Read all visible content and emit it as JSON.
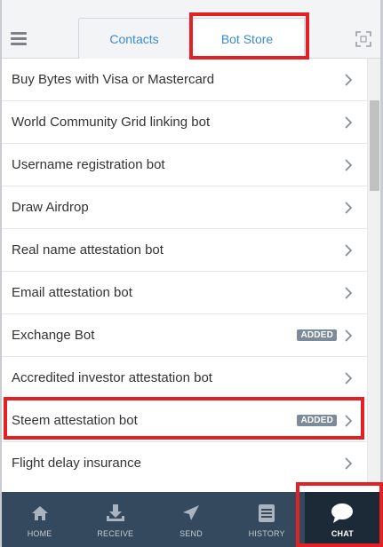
{
  "header": {
    "tabs": [
      {
        "label": "Contacts",
        "active": false
      },
      {
        "label": "Bot Store",
        "active": true
      }
    ]
  },
  "bots": [
    {
      "label": "Buy Bytes with Visa or Mastercard",
      "badge": ""
    },
    {
      "label": "World Community Grid linking bot",
      "badge": ""
    },
    {
      "label": "Username registration bot",
      "badge": ""
    },
    {
      "label": "Draw Airdrop",
      "badge": ""
    },
    {
      "label": "Real name attestation bot",
      "badge": ""
    },
    {
      "label": "Email attestation bot",
      "badge": ""
    },
    {
      "label": "Exchange Bot",
      "badge": "ADDED"
    },
    {
      "label": "Accredited investor attestation bot",
      "badge": ""
    },
    {
      "label": "Steem attestation bot",
      "badge": "ADDED"
    },
    {
      "label": "Flight delay insurance",
      "badge": ""
    }
  ],
  "nav": [
    {
      "label": "HOME",
      "icon": "home-icon",
      "active": false
    },
    {
      "label": "RECEIVE",
      "icon": "receive-icon",
      "active": false
    },
    {
      "label": "SEND",
      "icon": "send-icon",
      "active": false
    },
    {
      "label": "HISTORY",
      "icon": "history-icon",
      "active": false
    },
    {
      "label": "CHAT",
      "icon": "chat-icon",
      "active": true
    }
  ],
  "colors": {
    "accent": "#3a8cd0",
    "nav_bg": "#34495e",
    "nav_active_bg": "#1c2a38",
    "badge_bg": "#7d8a9a",
    "highlight": "#e32024"
  }
}
